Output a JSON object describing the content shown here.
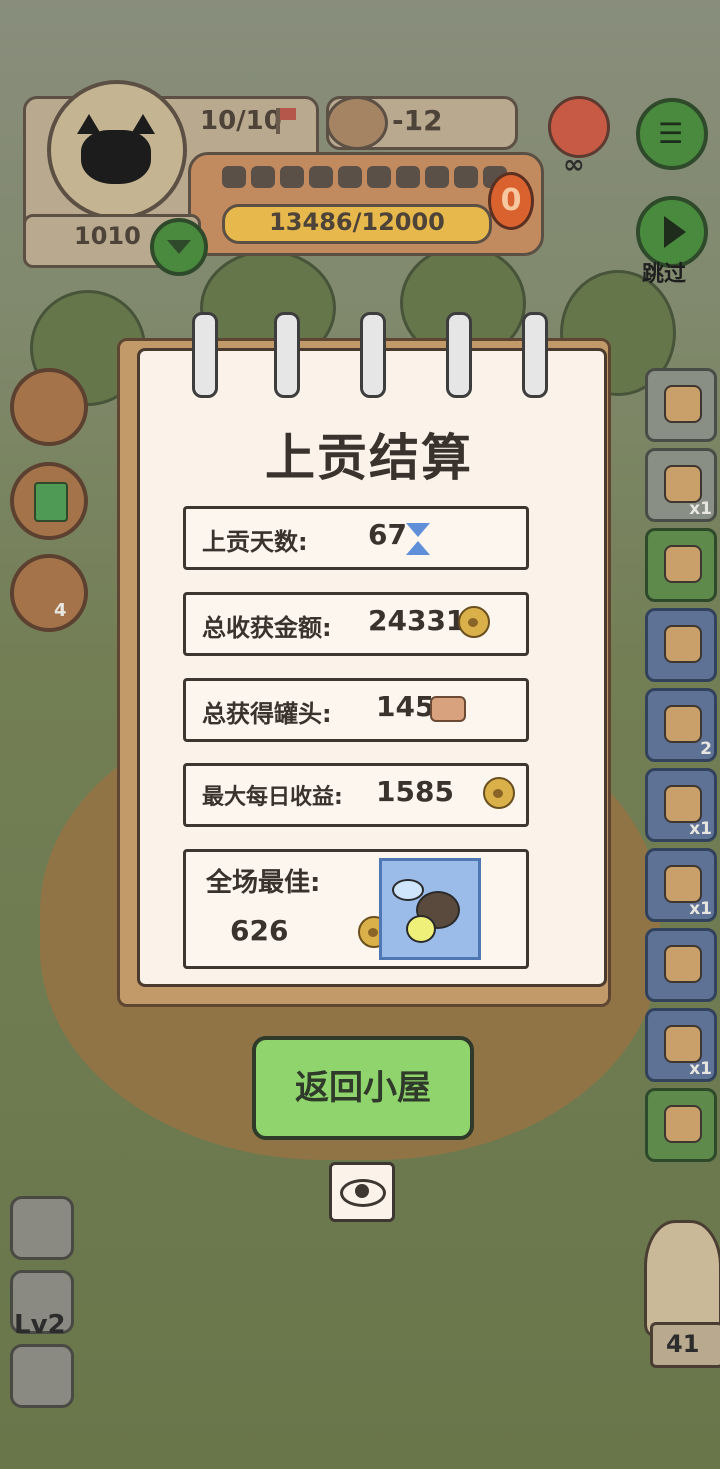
{
  "hud": {
    "energy": "10/10",
    "can_count": "-12",
    "progress": "13486/12000",
    "progress_fraction": 1.0,
    "segments_filled": 0,
    "segments_total": 10,
    "badge": "0",
    "coins": "1010",
    "skip_label": "跳过"
  },
  "report": {
    "title": "上贡结算",
    "rows": [
      {
        "label": "上贡天数:",
        "value": "67",
        "icon": "hourglass-icon"
      },
      {
        "label": "总收获金额:",
        "value": "24331",
        "icon": "paw-coin-icon"
      },
      {
        "label": "总获得罐头:",
        "value": "145",
        "icon": "can-icon"
      },
      {
        "label": "最大每日收益:",
        "value": "1585",
        "icon": "paw-coin-icon"
      }
    ],
    "best": {
      "label": "全场最佳:",
      "value": "626",
      "icon": "paw-coin-icon",
      "creature": "firefly-icon"
    },
    "home_button": "返回小屋"
  },
  "side_items": [
    {
      "name": "eggs-item",
      "qty": ""
    },
    {
      "name": "card-item",
      "qty": "x1"
    },
    {
      "name": "bowl-item",
      "qty": ""
    },
    {
      "name": "ticket-item",
      "qty": ""
    },
    {
      "name": "shovel-item",
      "qty": "2"
    },
    {
      "name": "binoculars-item",
      "qty": "x1"
    },
    {
      "name": "sickle-item",
      "qty": "x1"
    },
    {
      "name": "basket-item",
      "qty": ""
    },
    {
      "name": "seed-bag-item",
      "qty": "x1"
    },
    {
      "name": "coupon-item",
      "qty": ""
    }
  ],
  "left_items": {
    "timer_badge": "4",
    "level_label": "Lv2"
  },
  "owl_count": "41"
}
